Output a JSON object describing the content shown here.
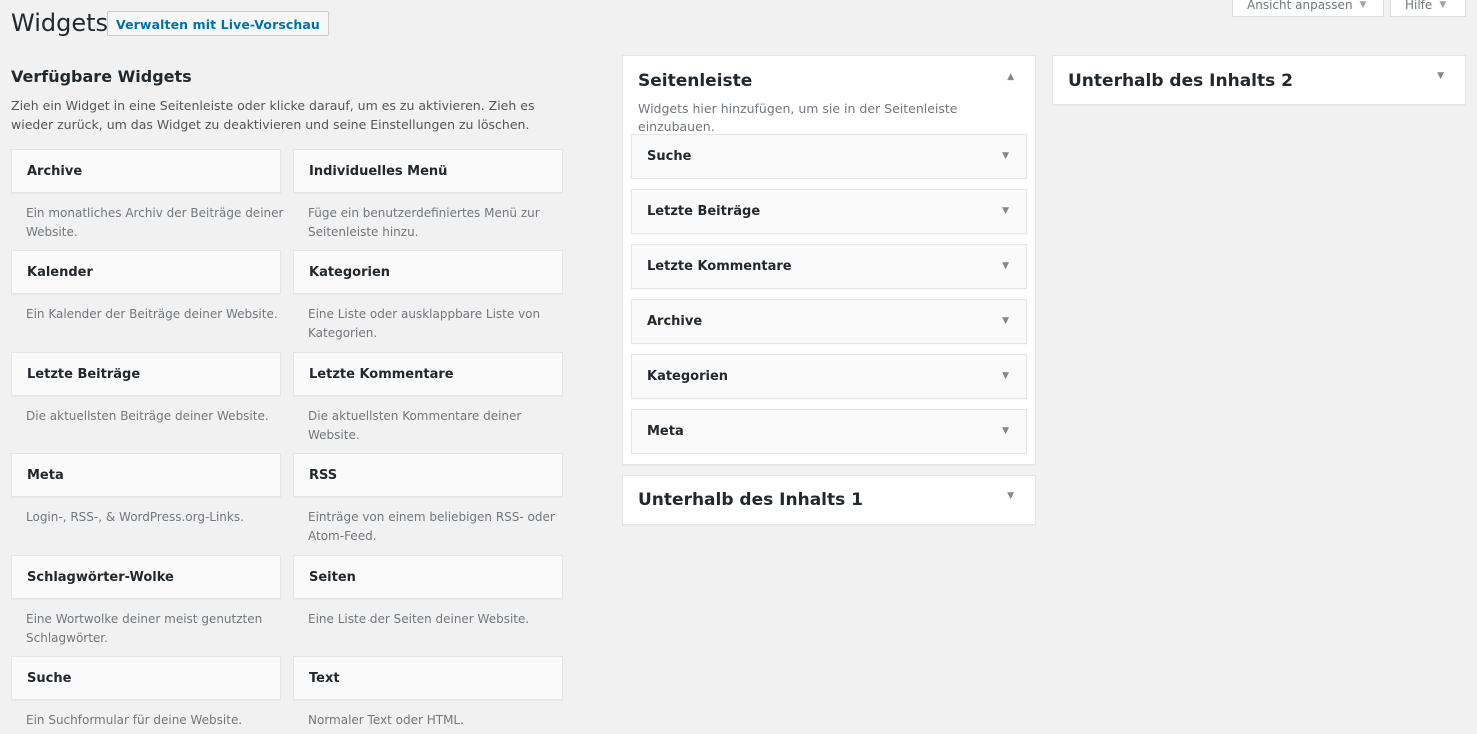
{
  "header": {
    "title": "Widgets",
    "live_preview_button": "Verwalten mit Live-Vorschau",
    "screen_options_tab": "Ansicht anpassen",
    "help_tab": "Hilfe",
    "tab_arrow": "▼"
  },
  "available": {
    "title": "Verfügbare Widgets",
    "description": "Zieh ein Widget in eine Seitenleiste oder klicke darauf, um es zu aktivieren. Zieh es wieder zurück, um das Widget zu deaktivieren und seine Einstellungen zu löschen.",
    "widgets": [
      {
        "name": "Archive",
        "description": "Ein monatliches Archiv der Beiträge deiner Website."
      },
      {
        "name": "Individuelles Menü",
        "description": "Füge ein benutzerdefiniertes Menü zur Seitenleiste hinzu."
      },
      {
        "name": "Kalender",
        "description": "Ein Kalender der Beiträge deiner Website."
      },
      {
        "name": "Kategorien",
        "description": "Eine Liste oder ausklappbare Liste von Kategorien."
      },
      {
        "name": "Letzte Beiträge",
        "description": "Die aktuellsten Beiträge deiner Website."
      },
      {
        "name": "Letzte Kommentare",
        "description": "Die aktuellsten Kommentare deiner Website."
      },
      {
        "name": "Meta",
        "description": "Login-, RSS-, & WordPress.org-Links."
      },
      {
        "name": "RSS",
        "description": "Einträge von einem beliebigen RSS- oder Atom-Feed."
      },
      {
        "name": "Schlagwörter-Wolke",
        "description": "Eine Wortwolke deiner meist genutzten Schlagwörter."
      },
      {
        "name": "Seiten",
        "description": "Eine Liste der Seiten deiner Website."
      },
      {
        "name": "Suche",
        "description": "Ein Suchformular für deine Website."
      },
      {
        "name": "Text",
        "description": "Normaler Text oder HTML."
      }
    ]
  },
  "sidebar": {
    "title": "Seitenleiste",
    "toggle": "▲",
    "description": "Widgets hier hinzufügen, um sie in der Seitenleiste einzubauen.",
    "item_arrow": "▼",
    "items": [
      {
        "name": "Suche"
      },
      {
        "name": "Letzte Beiträge"
      },
      {
        "name": "Letzte Kommentare"
      },
      {
        "name": "Archive"
      },
      {
        "name": "Kategorien"
      },
      {
        "name": "Meta"
      }
    ]
  },
  "below_content_1": {
    "title": "Unterhalb des Inhalts 1",
    "toggle": "▼"
  },
  "below_content_2": {
    "title": "Unterhalb des Inhalts 2",
    "toggle": "▼"
  },
  "colors": {
    "background": "#f1f1f1",
    "link": "#0073aa",
    "text": "#23282d",
    "muted": "#72777c"
  }
}
